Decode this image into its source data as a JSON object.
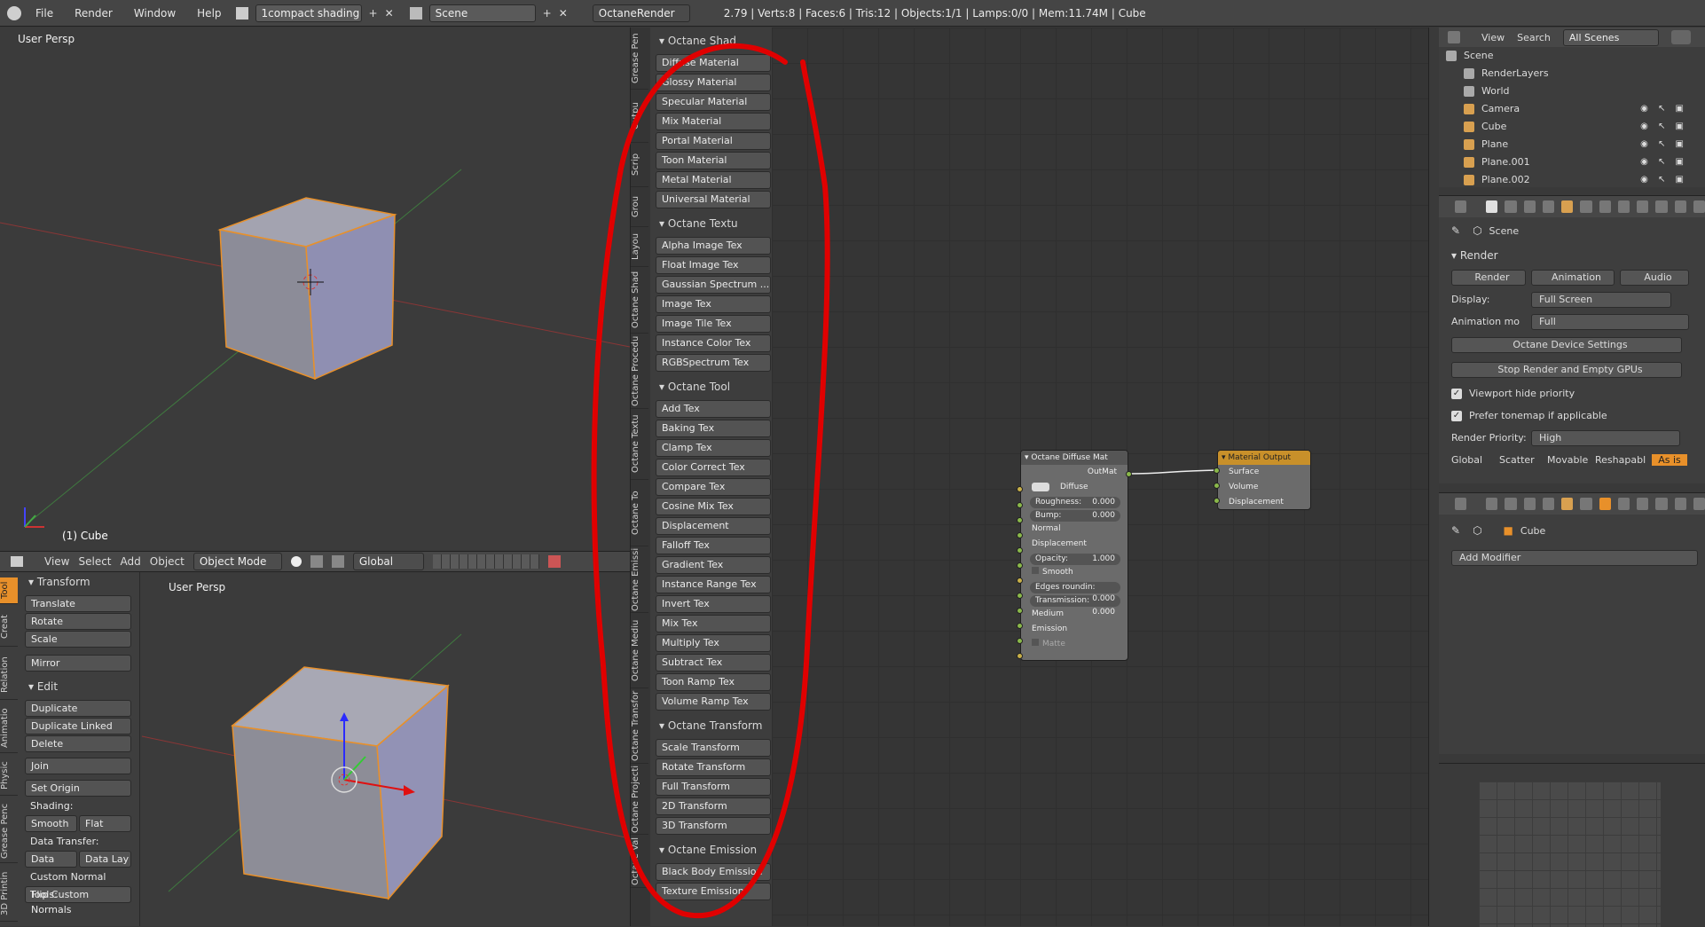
{
  "topbar": {
    "menus": [
      "File",
      "Render",
      "Window",
      "Help"
    ],
    "screen_layout": "1compact shading",
    "scene": "Scene",
    "engine": "OctaneRender",
    "stats": "2.79 | Verts:8 | Faces:6 | Tris:12 | Objects:1/1 | Lamps:0/0 | Mem:11.74M | Cube"
  },
  "viewport_top": {
    "label": "User Persp",
    "object_label": "(1) Cube"
  },
  "viewport_header": {
    "view": "View",
    "select": "Select",
    "add": "Add",
    "object": "Object",
    "mode": "Object Mode",
    "orientation": "Global"
  },
  "viewport_bottom": {
    "label": "User Persp"
  },
  "tool_shelf": {
    "tabs": [
      "Tool",
      "Creat",
      "Relation",
      "Animatio",
      "Physic",
      "Grease Penc",
      "3D Printin"
    ],
    "transform_title": "Transform",
    "transform_buttons": [
      "Translate",
      "Rotate",
      "Scale",
      "Mirror"
    ],
    "edit_title": "Edit",
    "edit_buttons": [
      "Duplicate",
      "Duplicate Linked",
      "Delete",
      "Join",
      "Set Origin"
    ],
    "shading_label": "Shading:",
    "smooth": "Smooth",
    "flat": "Flat",
    "data_transfer_label": "Data Transfer:",
    "data": "Data",
    "data_lay": "Data Lay",
    "custom_normal": "Custom Normal Tools:",
    "flip": "Flip Custom Normals"
  },
  "node_tabs": [
    "Grease Pen",
    "Outpu",
    "Scrip",
    "Grou",
    "Layou",
    "Octane Shad",
    "Octane Procedu",
    "Octane Textu",
    "Octane To",
    "Octane Emissi",
    "Octane Mediu",
    "Octane Transfor",
    "Octane Projecti",
    "Octane Val"
  ],
  "node_sections": [
    {
      "title": "Octane Shad",
      "items": [
        "Diffuse Material",
        "Glossy Material",
        "Specular Material",
        "Mix Material",
        "Portal Material",
        "Toon Material",
        "Metal Material",
        "Universal Material"
      ]
    },
    {
      "title": "Octane Textu",
      "items": [
        "Alpha Image Tex",
        "Float Image Tex",
        "Gaussian Spectrum ...",
        "Image Tex",
        "Image Tile Tex",
        "Instance Color Tex",
        "RGBSpectrum Tex"
      ]
    },
    {
      "title": "Octane Tool",
      "items": [
        "Add Tex",
        "Baking Tex",
        "Clamp Tex",
        "Color Correct Tex",
        "Compare Tex",
        "Cosine Mix Tex",
        "Displacement",
        "Falloff Tex",
        "Gradient Tex",
        "Instance Range Tex",
        "Invert Tex",
        "Mix Tex",
        "Multiply Tex",
        "Subtract Tex",
        "Toon Ramp Tex",
        "Volume Ramp Tex"
      ]
    },
    {
      "title": "Octane Transform",
      "items": [
        "Scale Transform",
        "Rotate Transform",
        "Full Transform",
        "2D Transform",
        "3D Transform"
      ]
    },
    {
      "title": "Octane Emission",
      "items": [
        "Black Body Emission",
        "Texture Emission"
      ]
    }
  ],
  "diffuse_node": {
    "title": "Octane Diffuse Mat",
    "output": "OutMat",
    "diffuse": "Diffuse",
    "roughness_label": "Roughness:",
    "roughness": "0.000",
    "bump_label": "Bump:",
    "bump": "0.000",
    "normal": "Normal",
    "displacement": "Displacement",
    "opacity_label": "Opacity:",
    "opacity": "1.000",
    "smooth": "Smooth",
    "edges_label": "Edges roundin:",
    "edges": "0.000",
    "transmission_label": "Transmission:",
    "transmission": "0.000",
    "medium": "Medium",
    "emission": "Emission",
    "matte": "Matte"
  },
  "output_node": {
    "title": "Material Output",
    "surface": "Surface",
    "volume": "Volume",
    "displacement": "Displacement"
  },
  "outliner": {
    "view": "View",
    "search": "Search",
    "scenes": "All Scenes",
    "items": [
      "Scene",
      "RenderLayers",
      "World",
      "Camera",
      "Cube",
      "Plane",
      "Plane.001",
      "Plane.002"
    ]
  },
  "properties": {
    "scene": "Scene",
    "render_title": "Render",
    "render_btn": "Render",
    "animation_btn": "Animation",
    "audio_btn": "Audio",
    "display_label": "Display:",
    "display_value": "Full Screen",
    "anim_label": "Animation mo",
    "anim_value": "Full",
    "device_settings": "Octane Device Settings",
    "stop_render": "Stop Render and Empty GPUs",
    "viewport_hide": "Viewport hide priority",
    "prefer_tonemap": "Prefer tonemap if applicable",
    "priority_label": "Render Priority:",
    "priority_value": "High",
    "bottom_tabs": [
      "Global",
      "Scatter",
      "Movable",
      "Reshapabl",
      "As is"
    ]
  },
  "modifiers": {
    "object": "Cube",
    "add_modifier": "Add Modifier"
  },
  "colors": {
    "accent": "#e8902a",
    "annotation": "#e00000",
    "socket_green": "#8ab84a",
    "socket_yellow": "#c8b048"
  }
}
